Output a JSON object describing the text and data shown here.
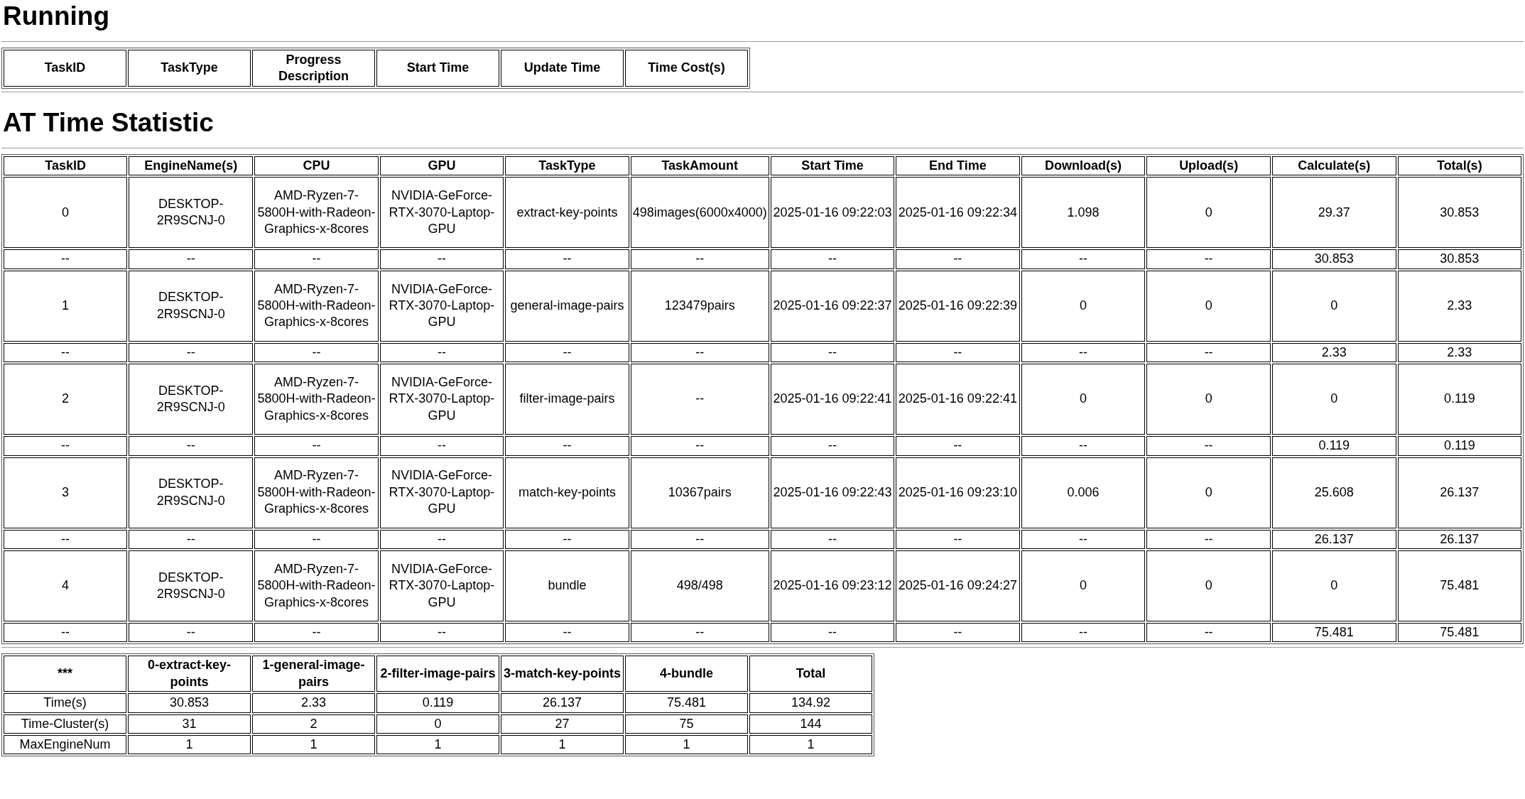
{
  "running": {
    "title": "Running",
    "columns": [
      "TaskID",
      "TaskType",
      "Progress Description",
      "Start Time",
      "Update Time",
      "Time Cost(s)"
    ]
  },
  "statistic": {
    "title": "AT Time Statistic",
    "columns": [
      "TaskID",
      "EngineName(s)",
      "CPU",
      "GPU",
      "TaskType",
      "TaskAmount",
      "Start Time",
      "End Time",
      "Download(s)",
      "Upload(s)",
      "Calculate(s)",
      "Total(s)"
    ],
    "rows": [
      [
        "0",
        "DESKTOP-2R9SCNJ-0",
        "AMD-Ryzen-7-5800H-with-Radeon-Graphics-x-8cores",
        "NVIDIA-GeForce-RTX-3070-Laptop-GPU",
        "extract-key-points",
        "498images(6000x4000)",
        "2025-01-16 09:22:03",
        "2025-01-16 09:22:34",
        "1.098",
        "0",
        "29.37",
        "30.853"
      ],
      [
        "--",
        "--",
        "--",
        "--",
        "--",
        "--",
        "--",
        "--",
        "--",
        "--",
        "30.853",
        "30.853"
      ],
      [
        "1",
        "DESKTOP-2R9SCNJ-0",
        "AMD-Ryzen-7-5800H-with-Radeon-Graphics-x-8cores",
        "NVIDIA-GeForce-RTX-3070-Laptop-GPU",
        "general-image-pairs",
        "123479pairs",
        "2025-01-16 09:22:37",
        "2025-01-16 09:22:39",
        "0",
        "0",
        "0",
        "2.33"
      ],
      [
        "--",
        "--",
        "--",
        "--",
        "--",
        "--",
        "--",
        "--",
        "--",
        "--",
        "2.33",
        "2.33"
      ],
      [
        "2",
        "DESKTOP-2R9SCNJ-0",
        "AMD-Ryzen-7-5800H-with-Radeon-Graphics-x-8cores",
        "NVIDIA-GeForce-RTX-3070-Laptop-GPU",
        "filter-image-pairs",
        "--",
        "2025-01-16 09:22:41",
        "2025-01-16 09:22:41",
        "0",
        "0",
        "0",
        "0.119"
      ],
      [
        "--",
        "--",
        "--",
        "--",
        "--",
        "--",
        "--",
        "--",
        "--",
        "--",
        "0.119",
        "0.119"
      ],
      [
        "3",
        "DESKTOP-2R9SCNJ-0",
        "AMD-Ryzen-7-5800H-with-Radeon-Graphics-x-8cores",
        "NVIDIA-GeForce-RTX-3070-Laptop-GPU",
        "match-key-points",
        "10367pairs",
        "2025-01-16 09:22:43",
        "2025-01-16 09:23:10",
        "0.006",
        "0",
        "25.608",
        "26.137"
      ],
      [
        "--",
        "--",
        "--",
        "--",
        "--",
        "--",
        "--",
        "--",
        "--",
        "--",
        "26.137",
        "26.137"
      ],
      [
        "4",
        "DESKTOP-2R9SCNJ-0",
        "AMD-Ryzen-7-5800H-with-Radeon-Graphics-x-8cores",
        "NVIDIA-GeForce-RTX-3070-Laptop-GPU",
        "bundle",
        "498/498",
        "2025-01-16 09:23:12",
        "2025-01-16 09:24:27",
        "0",
        "0",
        "0",
        "75.481"
      ],
      [
        "--",
        "--",
        "--",
        "--",
        "--",
        "--",
        "--",
        "--",
        "--",
        "--",
        "75.481",
        "75.481"
      ]
    ]
  },
  "summary": {
    "columns": [
      "***",
      "0-extract-key-points",
      "1-general-image-pairs",
      "2-filter-image-pairs",
      "3-match-key-points",
      "4-bundle",
      "Total"
    ],
    "rows": [
      [
        "Time(s)",
        "30.853",
        "2.33",
        "0.119",
        "26.137",
        "75.481",
        "134.92"
      ],
      [
        "Time-Cluster(s)",
        "31",
        "2",
        "0",
        "27",
        "75",
        "144"
      ],
      [
        "MaxEngineNum",
        "1",
        "1",
        "1",
        "1",
        "1",
        "1"
      ]
    ]
  }
}
